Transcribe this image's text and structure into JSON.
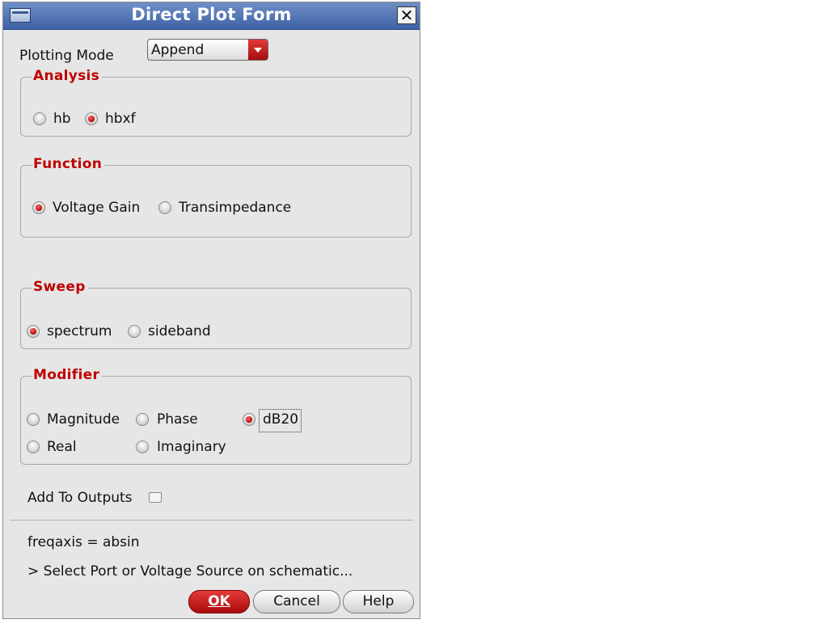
{
  "window": {
    "title": "Direct Plot Form"
  },
  "plotting_mode": {
    "label": "Plotting Mode",
    "value": "Append"
  },
  "analysis": {
    "title": "Analysis",
    "options": [
      "hb",
      "hbxf"
    ],
    "selected": "hbxf"
  },
  "function": {
    "title": "Function",
    "options": [
      "Voltage Gain",
      "Transimpedance"
    ],
    "selected": "Voltage Gain"
  },
  "sweep": {
    "title": "Sweep",
    "options": [
      "spectrum",
      "sideband"
    ],
    "selected": "spectrum"
  },
  "modifier": {
    "title": "Modifier",
    "options": [
      "Magnitude",
      "Phase",
      "dB20",
      "Real",
      "Imaginary"
    ],
    "selected": "dB20"
  },
  "add_to_outputs": {
    "label": "Add To Outputs",
    "checked": false
  },
  "status": {
    "freqaxis": "freqaxis = absin",
    "prompt": "> Select Port or Voltage Source on schematic..."
  },
  "buttons": {
    "ok": "OK",
    "cancel": "Cancel",
    "help": "Help"
  },
  "colors": {
    "accent": "#c00000",
    "titlebar": "#4a6db0"
  }
}
